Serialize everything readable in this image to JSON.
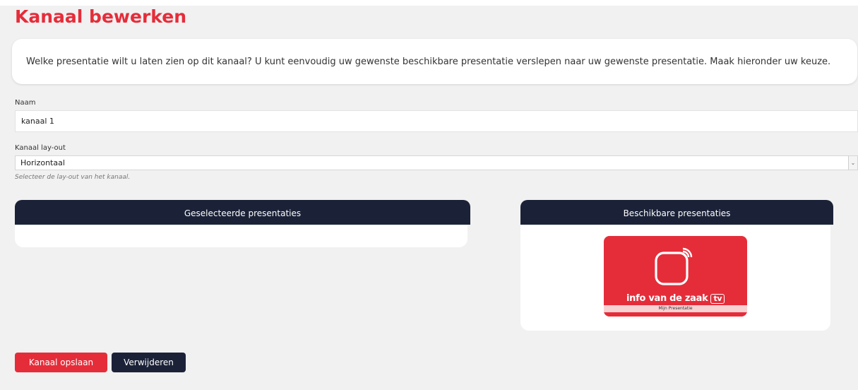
{
  "page": {
    "title": "Kanaal bewerken"
  },
  "intro": {
    "text": "Welke presentatie wilt u laten zien op dit kanaal? U kunt eenvoudig uw gewenste beschikbare presentatie verslepen naar uw gewenste presentatie. Maak hieronder uw keuze."
  },
  "form": {
    "name_label": "Naam",
    "name_value": "kanaal 1",
    "layout_label": "Kanaal lay-out",
    "layout_value": "Horizontaal",
    "layout_help": "Selecteer de lay-out van het kanaal."
  },
  "panels": {
    "selected_title": "Geselecteerde presentaties",
    "available_title": "Beschikbare presentaties",
    "available_items": [
      {
        "caption": "Mijn Presentatie",
        "brand_text": "info van de zaak",
        "brand_badge": "tv",
        "icon": "tv-wireless-icon",
        "color": "#e52d3a"
      }
    ]
  },
  "actions": {
    "save_label": "Kanaal opslaan",
    "delete_label": "Verwijderen"
  },
  "colors": {
    "accent": "#e52d3a",
    "dark": "#1b2238",
    "background": "#f1f1f1"
  },
  "icons": {
    "select_arrow": "chevron-down-icon"
  }
}
